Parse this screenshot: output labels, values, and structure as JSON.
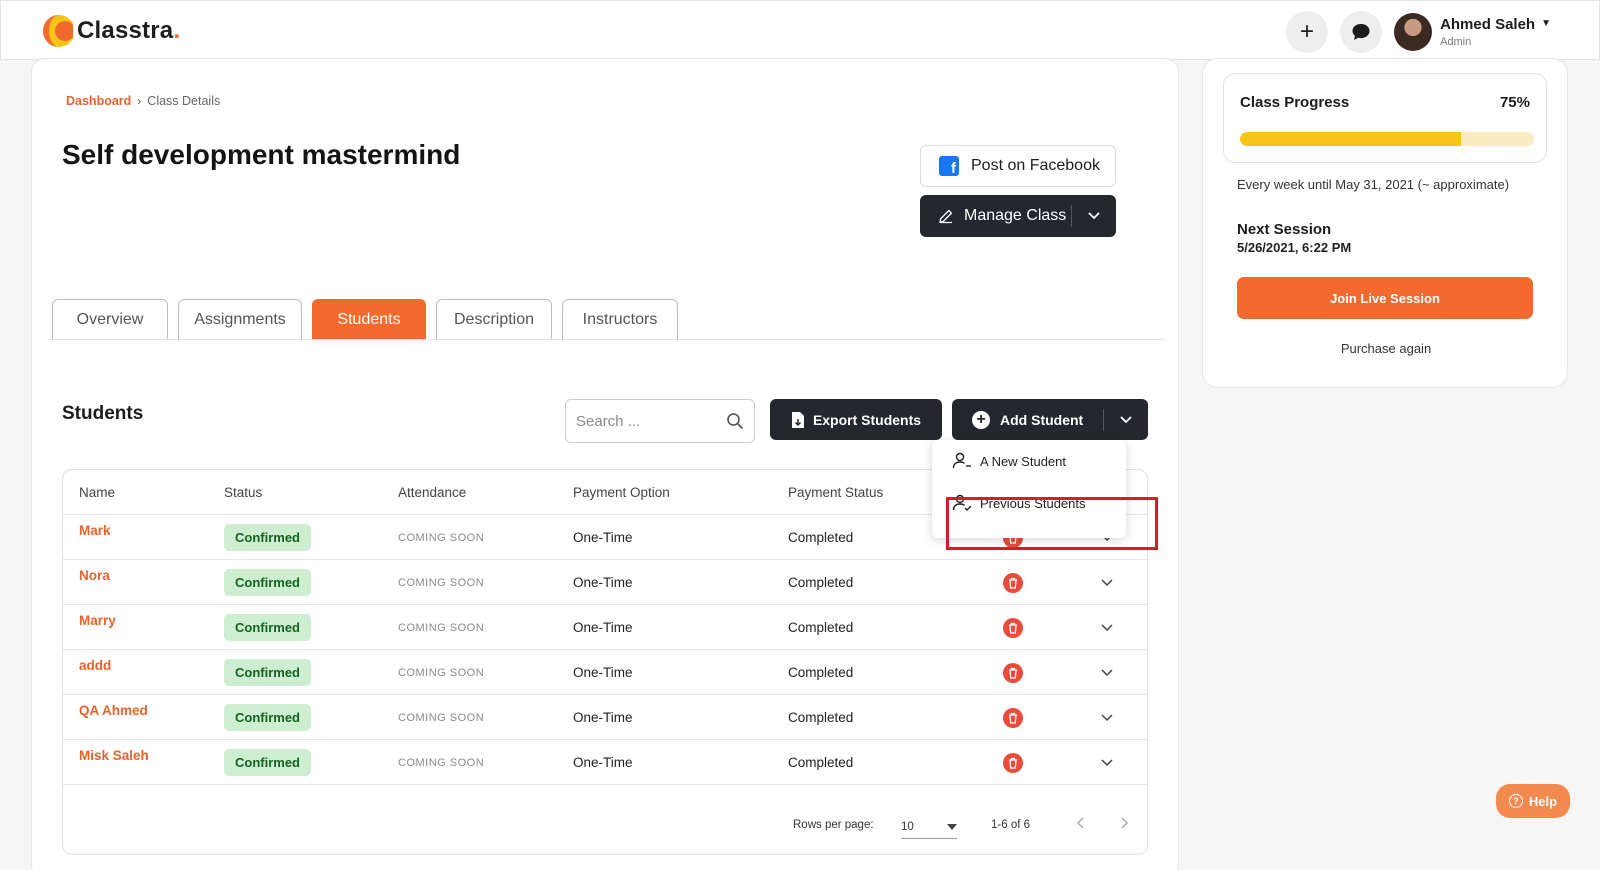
{
  "brand": {
    "name": "Classtra",
    "dot": ".",
    "accent": "#f26a2e"
  },
  "header": {
    "plus": "+",
    "user_name": "Ahmed Saleh",
    "user_role": "Admin"
  },
  "breadcrumb": {
    "home": "Dashboard",
    "current": "Class Details",
    "separator": "›"
  },
  "page_title": "Self development mastermind",
  "actions": {
    "facebook": "Post on Facebook",
    "manage": "Manage Class"
  },
  "tabs": [
    {
      "label": "Overview"
    },
    {
      "label": "Assignments"
    },
    {
      "label": "Students",
      "active": true
    },
    {
      "label": "Description"
    },
    {
      "label": "Instructors"
    }
  ],
  "students_section": {
    "title": "Students",
    "search_placeholder": "Search ...",
    "export_label": "Export Students",
    "add_label": "Add Student"
  },
  "add_menu": {
    "items": [
      "A New Student",
      "Previous Students"
    ],
    "highlighted": "Previous Students"
  },
  "table": {
    "columns": [
      "Name",
      "Status",
      "Attendance",
      "Payment Option",
      "Payment Status"
    ],
    "rows": [
      {
        "name": "Mark",
        "status": "Confirmed",
        "attendance": "COMING SOON",
        "payment_option": "One-Time",
        "payment_status": "Completed"
      },
      {
        "name": "Nora",
        "status": "Confirmed",
        "attendance": "COMING SOON",
        "payment_option": "One-Time",
        "payment_status": "Completed"
      },
      {
        "name": "Marry",
        "status": "Confirmed",
        "attendance": "COMING SOON",
        "payment_option": "One-Time",
        "payment_status": "Completed"
      },
      {
        "name": "addd",
        "status": "Confirmed",
        "attendance": "COMING SOON",
        "payment_option": "One-Time",
        "payment_status": "Completed"
      },
      {
        "name": "QA Ahmed",
        "status": "Confirmed",
        "attendance": "COMING SOON",
        "payment_option": "One-Time",
        "payment_status": "Completed"
      },
      {
        "name": "Misk Saleh",
        "status": "Confirmed",
        "attendance": "COMING SOON",
        "payment_option": "One-Time",
        "payment_status": "Completed"
      }
    ],
    "footer": {
      "rows_per_page_label": "Rows per page:",
      "rows_per_page": "10",
      "range": "1-6 of 6"
    }
  },
  "progress": {
    "title": "Class Progress",
    "percent_label": "75%",
    "value": 0.75
  },
  "schedule": "Every week until May 31, 2021 (~ approximate)",
  "next_session": {
    "label": "Next Session",
    "date": "5/26/2021, 6:22 PM"
  },
  "join_label": "Join Live Session",
  "purchase_label": "Purchase again",
  "help_label": "Help",
  "colors": {
    "status_green_bg": "#cdeed0",
    "status_green_text": "#13641f",
    "dark_button": "#24272d",
    "delete_red": "#e74c3c",
    "progress_fill": "#f5c518"
  }
}
